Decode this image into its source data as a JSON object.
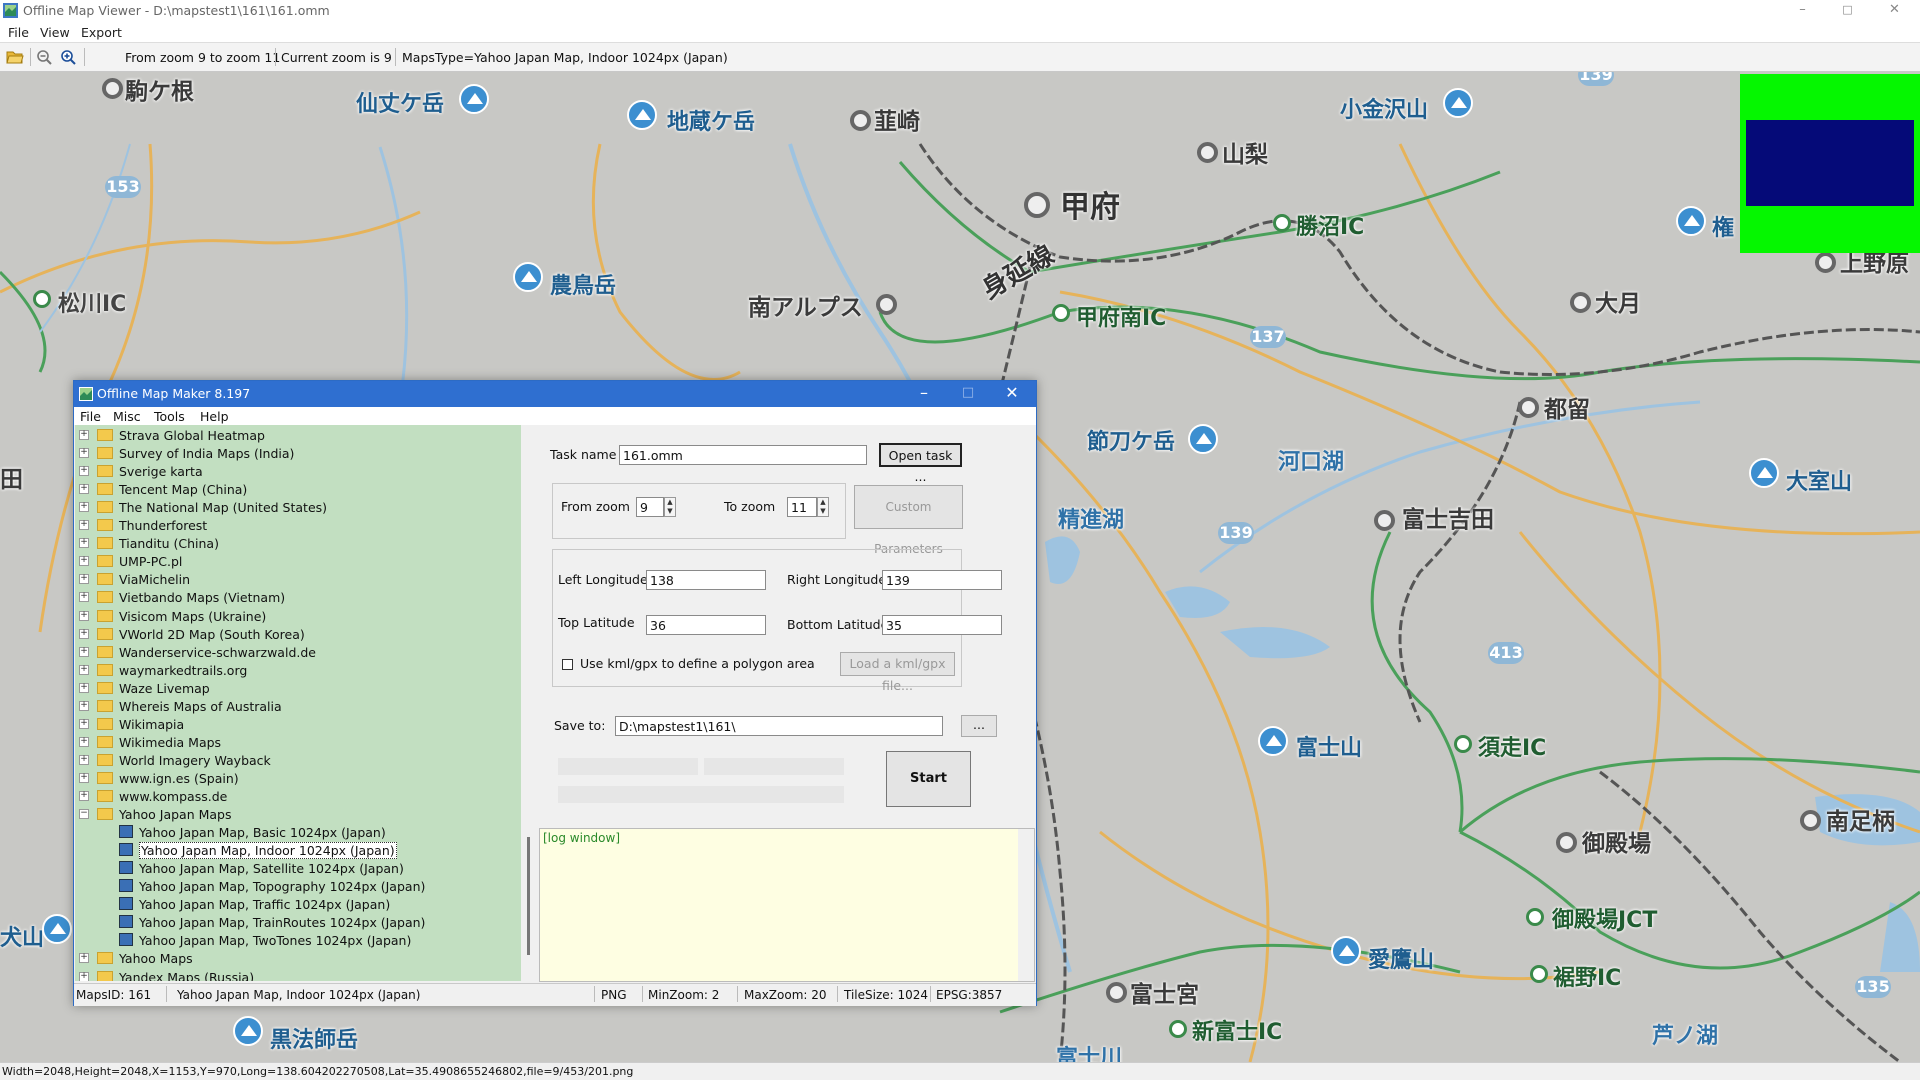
{
  "window": {
    "title": "Offline Map Viewer - D:\\mapstest1\\161\\161.omm",
    "controls": {
      "minimize": "–",
      "maximize": "□",
      "close": "✕"
    }
  },
  "menubar": {
    "file": "File",
    "view": "View",
    "export": "Export"
  },
  "toolbar": {
    "icons": [
      "open-folder-icon",
      "zoom-out-icon",
      "zoom-in-icon"
    ],
    "zoom_range": "From zoom 9 to zoom 11",
    "current_zoom": "Current zoom is 9",
    "maps_type": "MapsType=Yahoo Japan Map, Indoor 1024px (Japan)"
  },
  "map": {
    "labels": {
      "komagane": "駒ケ根",
      "senjo": "仙丈ケ岳",
      "jizo": "地蔵ケ岳",
      "nirasaki": "韮崎",
      "kanezawa": "小金沢山",
      "yamanashi": "山梨",
      "kofu": "甲府",
      "katsunuma": "勝沼IC",
      "ken": "権",
      "uenohara": "上野原",
      "matsukawa": "松川IC",
      "notori": "農鳥岳",
      "minami_alps": "南アルプス",
      "minobu_line": "身延線",
      "kofu_minami": "甲府南IC",
      "otsuki": "大月",
      "tsuru": "都留",
      "sengoku": "節刀ケ岳",
      "kawaguchiko": "河口湖",
      "omuro": "大室山",
      "shojiko": "精進湖",
      "fujiyoshida": "富士吉田",
      "fujisan": "富士山",
      "subashiri": "須走IC",
      "minami_ashigara": "南足柄",
      "gotemba": "御殿場",
      "gotemba_jct": "御殿場JCT",
      "aitaka": "愛鷹山",
      "susono": "裾野IC",
      "fujinomiya": "富士宮",
      "shin_fuji": "新富士IC",
      "ashinoko": "芦ノ湖",
      "kurohoshi": "黒法師岳",
      "fujikawa": "富士川",
      "left_yama": "犬山",
      "left_ta": "田"
    },
    "shields": [
      "139",
      "153",
      "137",
      "139",
      "413",
      "135"
    ]
  },
  "overview_colors": {
    "background": "#05f700",
    "viewport": "#050a78"
  },
  "status_bar": "Width=2048,Height=2048,X=1153,Y=970,Long=138.604202270508,Lat=35.4908655246802,file=9/453/201.png",
  "dialog": {
    "title": "Offline Map Maker 8.197",
    "menu": {
      "file": "File",
      "misc": "Misc",
      "tools": "Tools",
      "help": "Help"
    },
    "tree": [
      {
        "label": "Strava Global Heatmap",
        "type": "folder"
      },
      {
        "label": "Survey of India Maps (India)",
        "type": "folder"
      },
      {
        "label": "Sverige karta",
        "type": "folder"
      },
      {
        "label": "Tencent Map (China)",
        "type": "folder"
      },
      {
        "label": "The National Map (United States)",
        "type": "folder"
      },
      {
        "label": "Thunderforest",
        "type": "folder"
      },
      {
        "label": "Tianditu (China)",
        "type": "folder"
      },
      {
        "label": "UMP-PC.pl",
        "type": "folder"
      },
      {
        "label": "ViaMichelin",
        "type": "folder"
      },
      {
        "label": "Vietbando Maps (Vietnam)",
        "type": "folder"
      },
      {
        "label": "Visicom Maps (Ukraine)",
        "type": "folder"
      },
      {
        "label": "VWorld 2D Map (South Korea)",
        "type": "folder"
      },
      {
        "label": "Wanderservice-schwarzwald.de",
        "type": "folder"
      },
      {
        "label": "waymarkedtrails.org",
        "type": "folder"
      },
      {
        "label": "Waze Livemap",
        "type": "folder"
      },
      {
        "label": "Whereis Maps of Australia",
        "type": "folder"
      },
      {
        "label": "Wikimapia",
        "type": "folder"
      },
      {
        "label": "Wikimedia Maps",
        "type": "folder"
      },
      {
        "label": "World Imagery Wayback",
        "type": "folder"
      },
      {
        "label": "www.ign.es (Spain)",
        "type": "folder"
      },
      {
        "label": "www.kompass.de",
        "type": "folder"
      },
      {
        "label": "Yahoo Japan Maps",
        "type": "folder-open"
      },
      {
        "label": "Yahoo Japan Map, Basic 1024px (Japan)",
        "type": "map"
      },
      {
        "label": "Yahoo Japan Map, Indoor 1024px (Japan)",
        "type": "map",
        "selected": true
      },
      {
        "label": "Yahoo Japan Map, Satellite 1024px (Japan)",
        "type": "map"
      },
      {
        "label": "Yahoo Japan Map, Topography 1024px (Japan)",
        "type": "map"
      },
      {
        "label": "Yahoo Japan Map, Traffic 1024px (Japan)",
        "type": "map"
      },
      {
        "label": "Yahoo Japan Map, TrainRoutes 1024px (Japan)",
        "type": "map"
      },
      {
        "label": "Yahoo Japan Map, TwoTones 1024px (Japan)",
        "type": "map"
      },
      {
        "label": "Yahoo Maps",
        "type": "folder"
      },
      {
        "label": "Yandex Maps (Russia)",
        "type": "folder"
      }
    ],
    "form": {
      "task_name_label": "Task name",
      "task_name_value": "161.omm",
      "open_task": "Open task ...",
      "from_zoom_label": "From zoom",
      "from_zoom_value": "9",
      "to_zoom_label": "To zoom",
      "to_zoom_value": "11",
      "custom_params": "Custom Parameters",
      "left_lon_label": "Left Longitude",
      "left_lon_value": "138",
      "right_lon_label": "Right Longitude",
      "right_lon_value": "139",
      "top_lat_label": "Top Latitude",
      "top_lat_value": "36",
      "bottom_lat_label": "Bottom Latitude",
      "bottom_lat_value": "35",
      "kml_checkbox_label": "Use kml/gpx to define a polygon area",
      "load_kml": "Load a kml/gpx file...",
      "save_to_label": "Save to:",
      "save_to_value": "D:\\mapstest1\\161\\",
      "browse": "...",
      "start": "Start"
    },
    "log": "[log window]",
    "status": {
      "maps_id": "MapsID: 161",
      "maps_name": "Yahoo Japan Map, Indoor 1024px (Japan)",
      "format": "PNG",
      "min_zoom": "MinZoom: 2",
      "max_zoom": "MaxZoom: 20",
      "tile_size": "TileSize: 1024",
      "epsg": "EPSG:3857"
    }
  }
}
